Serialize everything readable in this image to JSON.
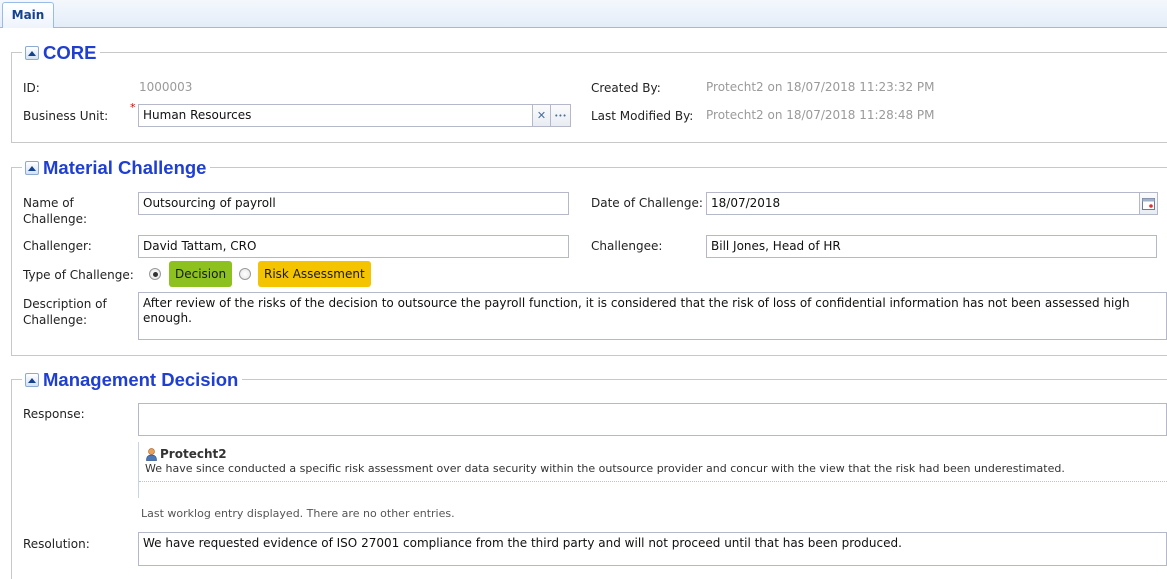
{
  "tabs": [
    {
      "label": "Main"
    }
  ],
  "core": {
    "title": "CORE",
    "id_label": "ID:",
    "id_value": "1000003",
    "business_unit_label": "Business Unit:",
    "business_unit_required": "*",
    "business_unit_value": "Human Resources",
    "clear_glyph": "✕",
    "more_glyph": "•••",
    "created_by_label": "Created By:",
    "created_by_value": "Protecht2 on 18/07/2018 11:23:32 PM",
    "modified_by_label": "Last Modified By:",
    "modified_by_value": "Protecht2 on 18/07/2018 11:28:48 PM"
  },
  "challenge": {
    "title": "Material Challenge",
    "name_label_line1": "Name of",
    "name_label_line2": "Challenge:",
    "name_value": "Outsourcing of payroll",
    "date_label": "Date of Challenge:",
    "date_value": "18/07/2018",
    "challenger_label": "Challenger:",
    "challenger_value": "David Tattam, CRO",
    "challengee_label": "Challengee:",
    "challengee_value": "Bill Jones, Head of HR",
    "type_label": "Type of Challenge:",
    "type_options": [
      {
        "label": "Decision",
        "selected": true,
        "color": "#8cc11f"
      },
      {
        "label": "Risk Assessment",
        "selected": false,
        "color": "#f5c400"
      }
    ],
    "description_label_line1": "Description of",
    "description_label_line2": "Challenge:",
    "description_value": "After review of the risks of the decision to outsource the payroll function, it is considered that the risk of loss of confidential information has not been assessed high enough."
  },
  "management": {
    "title": "Management Decision",
    "response_label": "Response:",
    "response_value": "",
    "worklog": {
      "user": "Protecht2",
      "text": "We have since conducted a specific risk assessment over data security within the outsource provider and concur with the view that the risk had been underestimated.",
      "note": "Last worklog entry displayed. There are no other entries."
    },
    "resolution_label": "Resolution:",
    "resolution_value": "We have requested evidence of ISO 27001 compliance from the third party and will not proceed until that has been produced."
  },
  "colors": {
    "section_title": "#1f3fd3",
    "decision_green": "#8cc11f",
    "risk_amber": "#f5c400",
    "required_star": "#dd0000"
  }
}
